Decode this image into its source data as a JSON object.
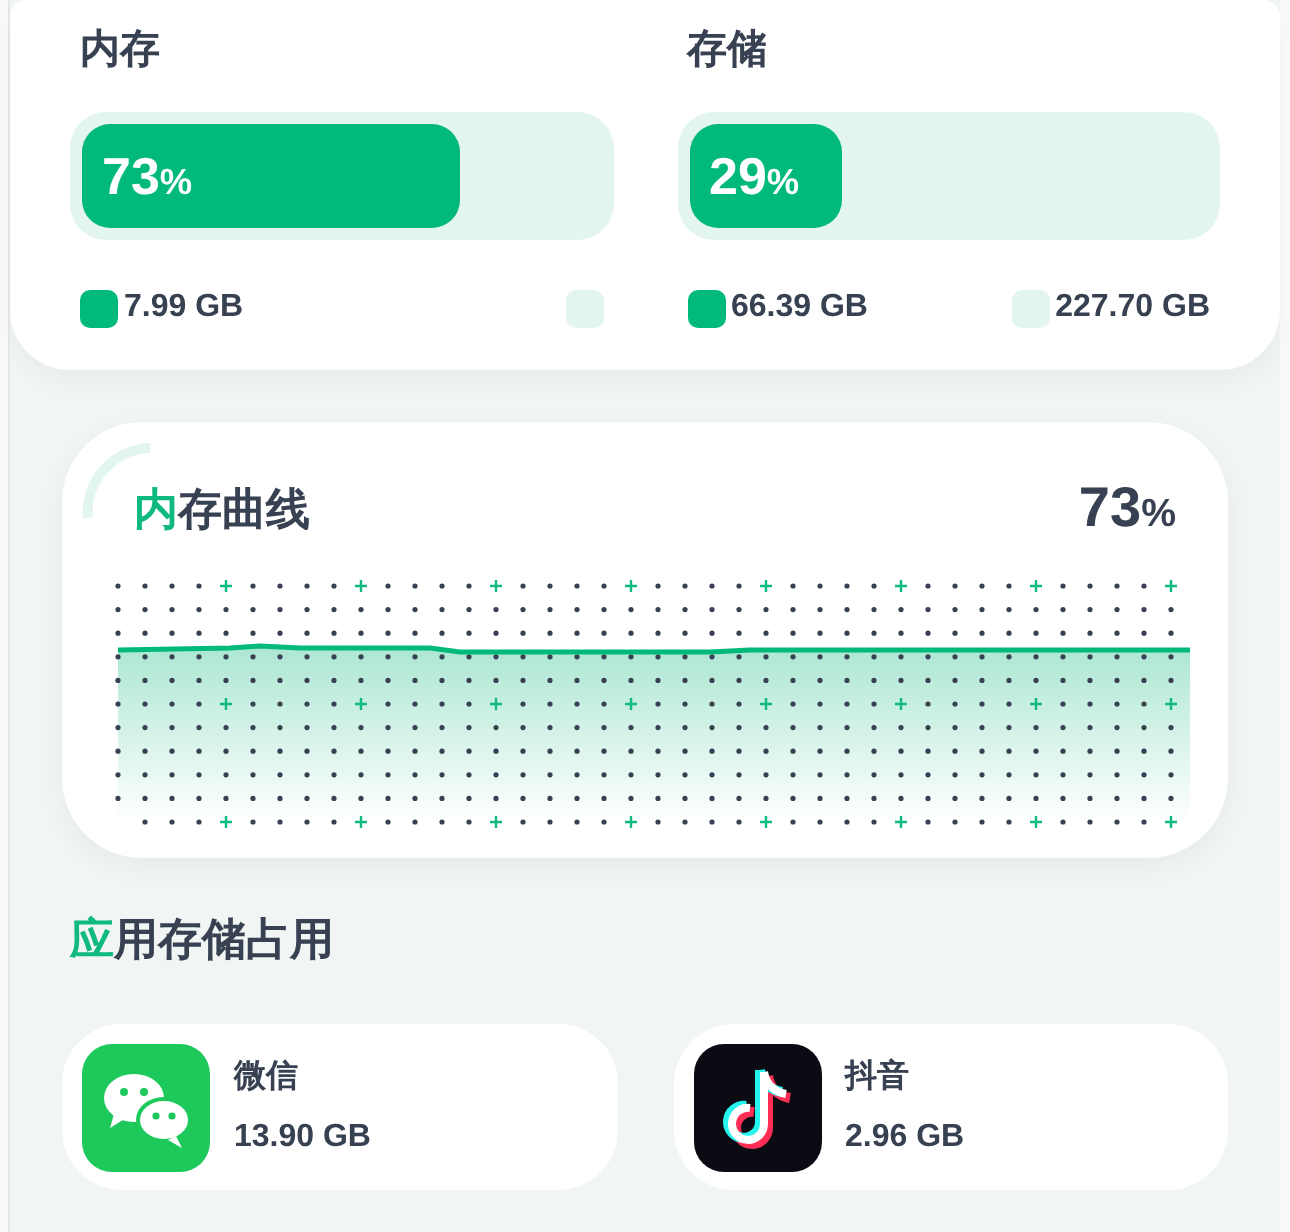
{
  "usage": [
    {
      "title": "内存",
      "level": 0.73,
      "percent": "73%",
      "legend": [
        {
          "kind": "used",
          "label": "7.99 GB"
        },
        {
          "kind": "free"
        }
      ]
    },
    {
      "title": "存储",
      "level": 0.29,
      "percent": "29%",
      "legend": [
        {
          "kind": "used",
          "label": "66.39 GB"
        },
        {
          "kind": "free",
          "label": "227.70 GB"
        }
      ]
    }
  ],
  "memory_curve": {
    "title": "内存曲线",
    "percent": "73%"
  },
  "app_storage": {
    "title": "应用存储占用",
    "apps": [
      {
        "kind": "wechat",
        "name": "微信",
        "size": "13.90 GB"
      },
      {
        "kind": "tiktok",
        "name": "抖音",
        "size": "2.96 GB"
      }
    ]
  }
}
